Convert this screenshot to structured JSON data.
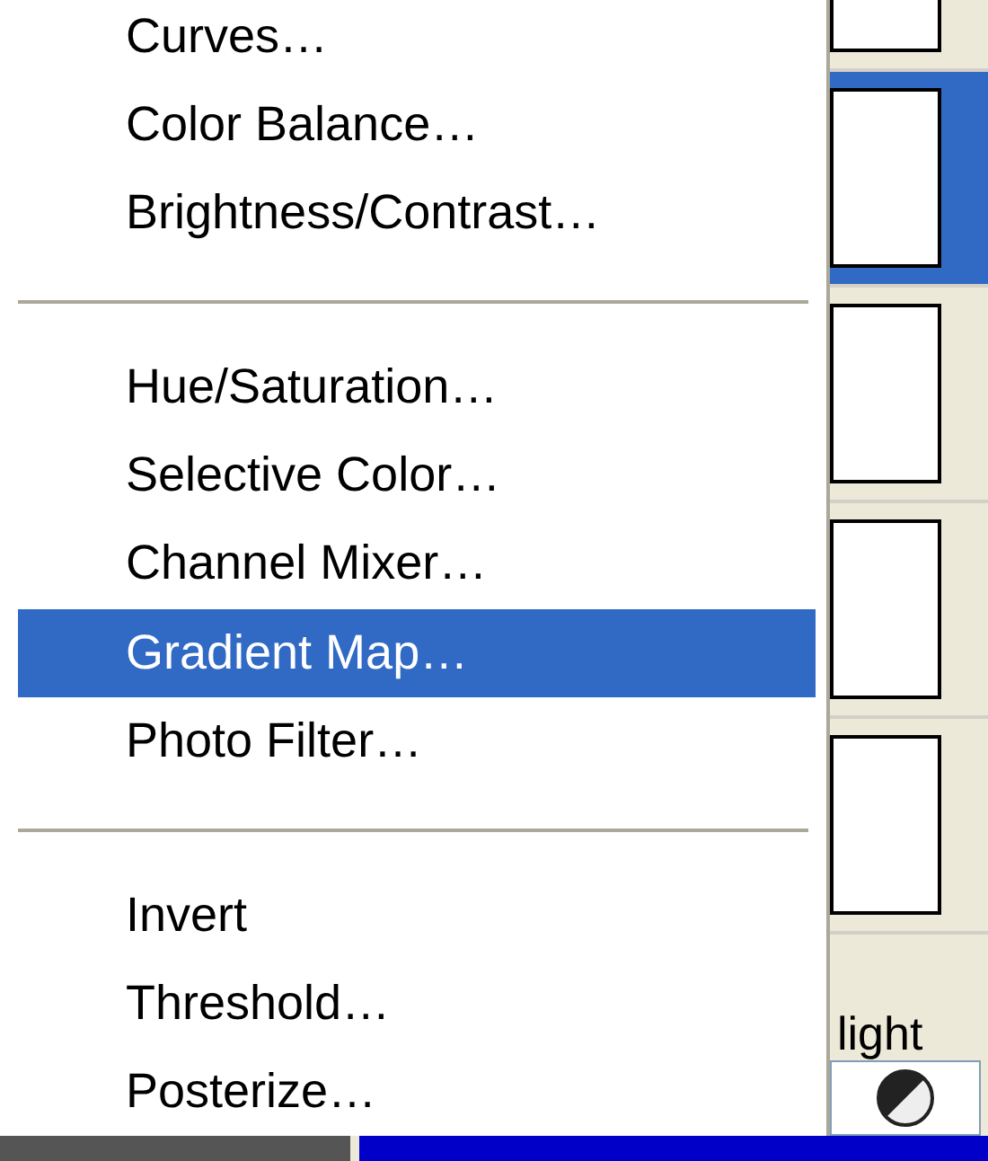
{
  "menu": {
    "items": [
      {
        "kind": "item",
        "label": "Curves…",
        "selected": false
      },
      {
        "kind": "item",
        "label": "Color Balance…",
        "selected": false
      },
      {
        "kind": "item",
        "label": "Brightness/Contrast…",
        "selected": false
      },
      {
        "kind": "separator"
      },
      {
        "kind": "item",
        "label": "Hue/Saturation…",
        "selected": false
      },
      {
        "kind": "item",
        "label": "Selective Color…",
        "selected": false
      },
      {
        "kind": "item",
        "label": "Channel Mixer…",
        "selected": false
      },
      {
        "kind": "item",
        "label": "Gradient Map…",
        "selected": true
      },
      {
        "kind": "item",
        "label": "Photo Filter…",
        "selected": false
      },
      {
        "kind": "separator"
      },
      {
        "kind": "item",
        "label": "Invert",
        "selected": false
      },
      {
        "kind": "item",
        "label": "Threshold…",
        "selected": false
      },
      {
        "kind": "item",
        "label": "Posterize…",
        "selected": false
      }
    ]
  },
  "layers": [
    {
      "selected": false
    },
    {
      "selected": true
    },
    {
      "selected": false
    },
    {
      "selected": false
    },
    {
      "selected": false
    }
  ],
  "panel_label": "light"
}
